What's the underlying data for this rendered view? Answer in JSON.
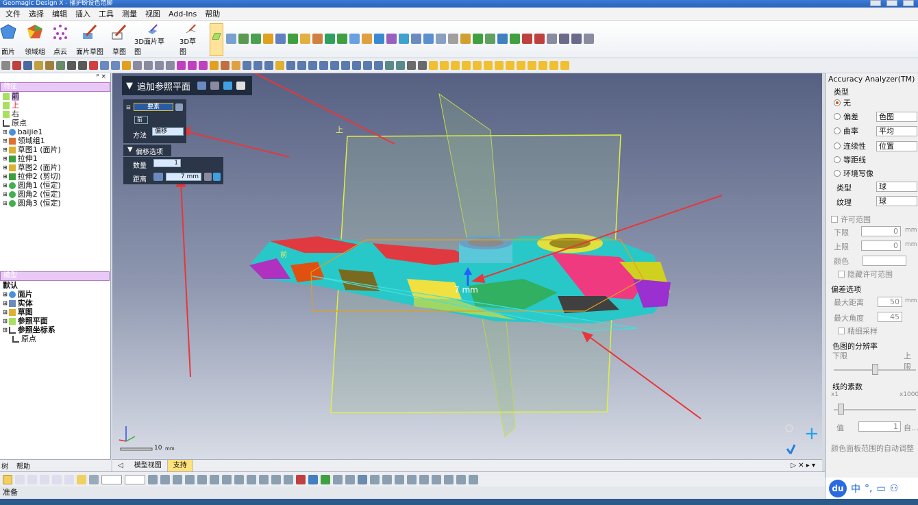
{
  "window": {
    "title": "Geomagic Design X - 播护盼设色范脚"
  },
  "menu": [
    "文件",
    "选择",
    "编辑",
    "插入",
    "工具",
    "测量",
    "视图",
    "Add-Ins",
    "帮助"
  ],
  "ribbon": {
    "tools": [
      {
        "label": "面片"
      },
      {
        "label": "领域组"
      },
      {
        "label": "点云"
      },
      {
        "label": "面片草图"
      },
      {
        "label": "草图"
      },
      {
        "label": "3D面片草图"
      },
      {
        "label": "3D草图"
      }
    ]
  },
  "feature_tree": {
    "header": "特征",
    "items": [
      {
        "label": "前"
      },
      {
        "label": "上"
      },
      {
        "label": "右"
      },
      {
        "label": "原点"
      },
      {
        "label": "baijie1"
      },
      {
        "label": "领域组1"
      },
      {
        "label": "草图1 (面片)"
      },
      {
        "label": "拉伸1"
      },
      {
        "label": "草图2 (面片)"
      },
      {
        "label": "拉伸2 (剪切)"
      },
      {
        "label": "圆角1 (恒定)"
      },
      {
        "label": "圆角2 (恒定)"
      },
      {
        "label": "圆角3 (恒定)"
      }
    ]
  },
  "model_tree": {
    "header": "模型",
    "items": [
      {
        "label": "默认"
      },
      {
        "label": "面片"
      },
      {
        "label": "实体"
      },
      {
        "label": "草图"
      },
      {
        "label": "参照平面"
      },
      {
        "label": "参照坐标系"
      },
      {
        "label": "原点"
      }
    ]
  },
  "left_tabs": [
    "树",
    "帮助"
  ],
  "dialog": {
    "title": "追加参照平面",
    "element_button": "要素",
    "selected_label": "前",
    "method_label": "方法",
    "method_value": "偏移",
    "offset_section": "偏移选项",
    "count_label": "数量",
    "count_value": "1",
    "distance_label": "距离",
    "distance_value": "7 mm"
  },
  "viewport": {
    "label_top": "上",
    "label_front": "前",
    "dimension": "7 mm",
    "scale_value": "10",
    "scale_unit": "mm"
  },
  "view_tabs": [
    "模型视图",
    "支持"
  ],
  "accuracy": {
    "title": "Accuracy Analyzer(TM)",
    "type_header": "类型",
    "radio_none": "无",
    "radio_deviation": "偏差",
    "combo_deviation": "色图",
    "radio_curvature": "曲率",
    "combo_curvature": "平均",
    "radio_continuity": "连续性",
    "combo_continuity": "位置",
    "radio_isoline": "等距线",
    "radio_env": "环境写像",
    "type_label": "类型",
    "type_value": "球",
    "texture_label": "纹理",
    "texture_value": "球",
    "tolerance_header": "许可范围",
    "lower_label": "下限",
    "lower_value": "0",
    "lower_unit": "mm",
    "upper_label": "上限",
    "upper_value": "0",
    "upper_unit": "mm",
    "color_label": "颜色",
    "hide_tolerance": "隐藏许可范围",
    "deviation_options": "偏差选项",
    "max_distance_label": "最大距离",
    "max_distance_value": "50",
    "max_distance_unit": "mm",
    "max_angle_label": "最大角度",
    "max_angle_value": "45",
    "fine_sampling": "精细采样",
    "resolution_header": "色图的分辨率",
    "res_lower": "下限",
    "res_upper": "上限",
    "line_factor_header": "线的素数",
    "factor_min": "x1",
    "factor_max": "x1000",
    "value_label": "值",
    "value_value": "1",
    "auto_label": "自...",
    "auto_adjust": "颜色面板范围的自动调整"
  },
  "status": {
    "text": "准备"
  },
  "ime": {
    "logo": "du",
    "lang": "中"
  },
  "colors": {
    "accent_purple": "#c9a6ea",
    "dialog_bg": "#1f2a3c",
    "active_tool": "#ffe39a",
    "arrow_red": "#e8363a"
  }
}
